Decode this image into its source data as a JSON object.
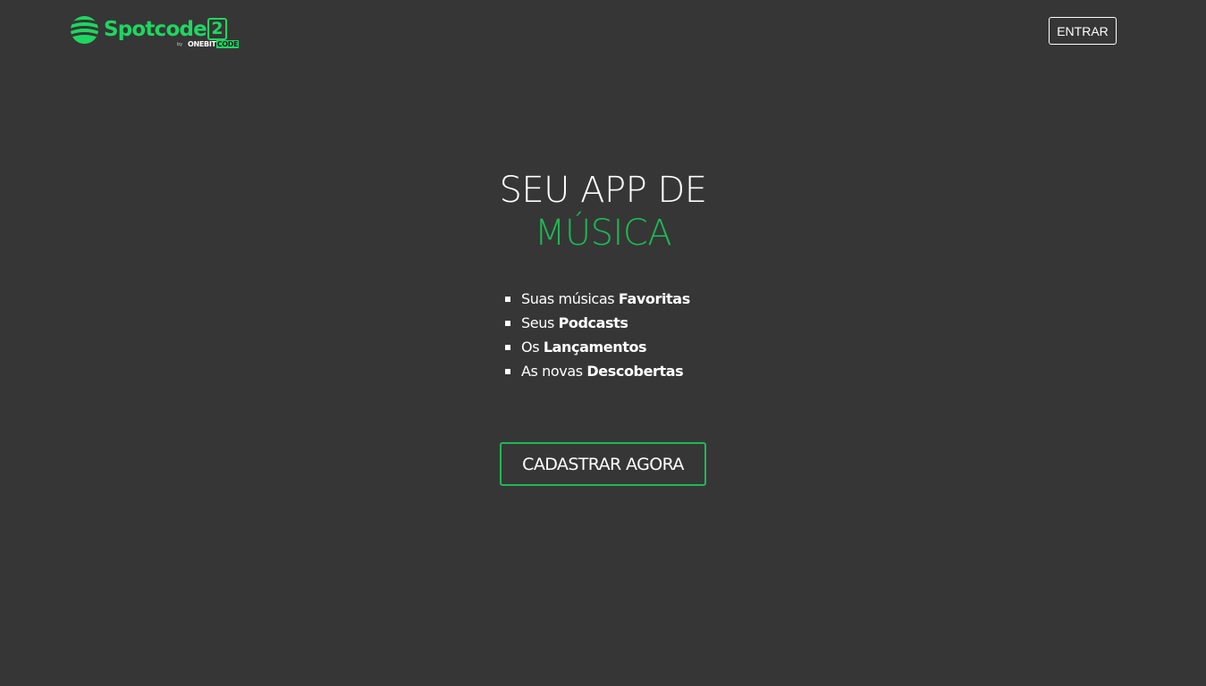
{
  "header": {
    "logo": {
      "wordmark": "Spotcode",
      "number": "2",
      "by": "by",
      "brand_one": "ONEBIT",
      "brand_two": "CODE"
    },
    "enter_label": "ENTRAR"
  },
  "hero": {
    "title_line1": "SEU APP DE",
    "title_line2": "MÚSICA"
  },
  "features": [
    {
      "text": "Suas músicas ",
      "bold": "Favoritas"
    },
    {
      "text": "Seus ",
      "bold": "Podcasts"
    },
    {
      "text": "Os ",
      "bold": "Lançamentos"
    },
    {
      "text": "As novas ",
      "bold": "Descobertas"
    }
  ],
  "cta": {
    "label": "CADASTRAR AGORA"
  },
  "colors": {
    "background": "#363636",
    "accent": "#1db954",
    "logo_green": "#1ed760",
    "text": "#ffffff"
  },
  "icons": {
    "logo_mark": "spotify-like-waves-logo-icon",
    "list_bullet": "square-bullet-icon"
  }
}
